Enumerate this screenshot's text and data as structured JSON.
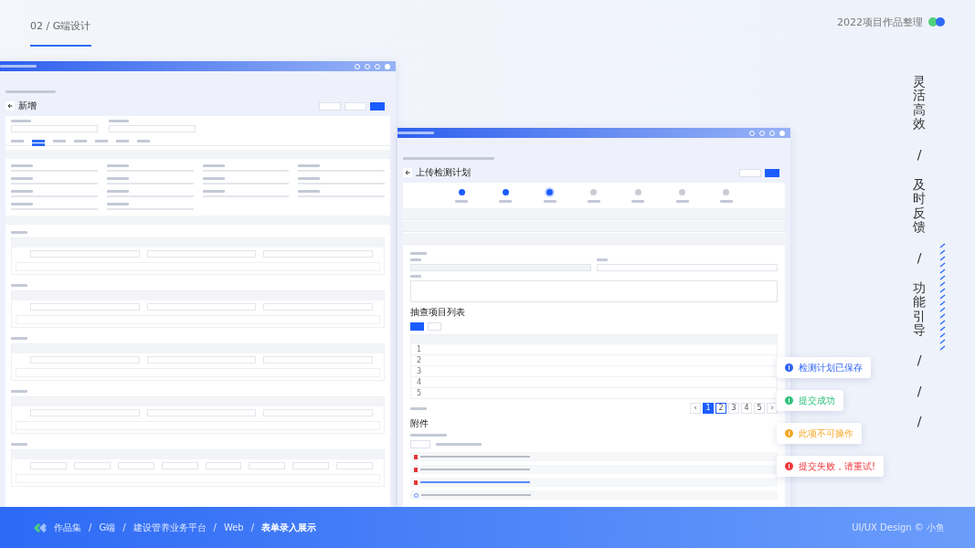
{
  "header": {
    "section": "02 / G端设计",
    "collection": "2022项目作品整理"
  },
  "form_window": {
    "title": "新增",
    "tabs": [
      {
        "selected": false
      },
      {
        "selected": true
      },
      {
        "selected": false
      },
      {
        "selected": false
      },
      {
        "selected": false
      },
      {
        "selected": false
      },
      {
        "selected": false
      }
    ]
  },
  "plan_window": {
    "title": "上传检测计划",
    "steps": [
      {
        "completed": true,
        "selected": false
      },
      {
        "completed": true,
        "selected": false
      },
      {
        "completed": false,
        "selected": true
      },
      {
        "completed": false,
        "selected": false
      },
      {
        "completed": false,
        "selected": false
      },
      {
        "completed": false,
        "selected": false
      },
      {
        "completed": false,
        "selected": false
      }
    ],
    "list_title": "抽查项目列表",
    "rows": [
      {
        "number": "1"
      },
      {
        "number": "2"
      },
      {
        "number": "3"
      },
      {
        "number": "4"
      },
      {
        "number": "5"
      }
    ],
    "pagination": [
      {
        "label": "‹",
        "selected": false,
        "focused": false
      },
      {
        "label": "1",
        "selected": true,
        "focused": false
      },
      {
        "label": "2",
        "selected": false,
        "focused": true
      },
      {
        "label": "3",
        "selected": false,
        "focused": false
      },
      {
        "label": "4",
        "selected": false,
        "focused": false
      },
      {
        "label": "5",
        "selected": false,
        "focused": false
      },
      {
        "label": "›",
        "selected": false,
        "focused": false
      }
    ],
    "attachments_title": "附件",
    "files": [
      {
        "kind": "pdf",
        "highlighted": false
      },
      {
        "kind": "pdf",
        "highlighted": false
      },
      {
        "kind": "pdf",
        "highlighted": true
      },
      {
        "kind": "uploading",
        "highlighted": false
      }
    ]
  },
  "toasts": [
    {
      "kind": "info",
      "text": "检测计划已保存"
    },
    {
      "kind": "success",
      "text": "提交成功"
    },
    {
      "kind": "warning",
      "text": "此项不可操作"
    },
    {
      "kind": "error",
      "text": "提交失败，请重试!"
    }
  ],
  "slogan": [
    "灵活高效",
    "/",
    "及时反馈",
    "/",
    "功能引导",
    "/",
    "/",
    "/"
  ],
  "footer": {
    "separator": "/",
    "crumbs": [
      "作品集",
      "G端",
      "建设管养业务平台",
      "Web",
      "表单录入展示"
    ],
    "credit": "UI/UX Design © 小鱼"
  }
}
